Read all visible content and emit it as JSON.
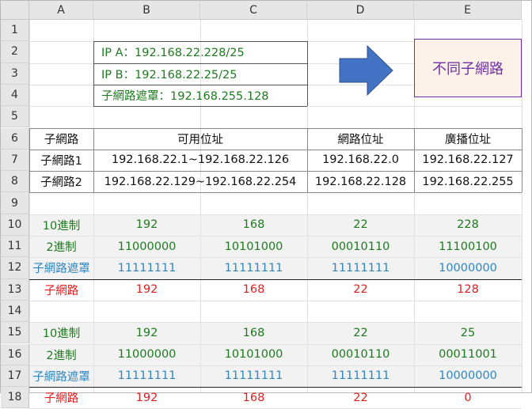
{
  "columns": [
    "A",
    "B",
    "C",
    "D",
    "E"
  ],
  "rows": [
    "1",
    "2",
    "3",
    "4",
    "5",
    "6",
    "7",
    "8",
    "9",
    "10",
    "11",
    "12",
    "13",
    "14",
    "15",
    "16",
    "17",
    "18"
  ],
  "info": {
    "ip_a": "IP A：192.168.22.228/25",
    "ip_b": "IP B：192.168.22.25/25",
    "mask": "子網路遮罩：192.168.255.128"
  },
  "result_box": {
    "text": "不同子網路",
    "border_color": "#7030a0",
    "fill_color": "#fdf2ea"
  },
  "arrow": {
    "color": "#4472c4"
  },
  "table": {
    "headers": [
      "子網路",
      "可用位址",
      "網路位址",
      "廣播位址"
    ],
    "rows": [
      [
        "子網路1",
        "192.168.22.1~192.168.22.126",
        "192.168.22.0",
        "192.168.22.127"
      ],
      [
        "子網路2",
        "192.168.22.129~192.168.22.254",
        "192.168.22.128",
        "192.168.22.255"
      ]
    ]
  },
  "block1": {
    "decimal": {
      "label": "10進制",
      "values": [
        "192",
        "168",
        "22",
        "228"
      ]
    },
    "binary": {
      "label": "2進制",
      "values": [
        "11000000",
        "10101000",
        "00010110",
        "11100100"
      ]
    },
    "mask": {
      "label": "子網路遮罩",
      "values": [
        "11111111",
        "11111111",
        "11111111",
        "10000000"
      ]
    },
    "subnet": {
      "label": "子網路",
      "values": [
        "192",
        "168",
        "22",
        "128"
      ]
    }
  },
  "block2": {
    "decimal": {
      "label": "10進制",
      "values": [
        "192",
        "168",
        "22",
        "25"
      ]
    },
    "binary": {
      "label": "2進制",
      "values": [
        "11000000",
        "10101000",
        "00010110",
        "00011001"
      ]
    },
    "mask": {
      "label": "子網路遮罩",
      "values": [
        "11111111",
        "11111111",
        "11111111",
        "10000000"
      ]
    },
    "subnet": {
      "label": "子網路",
      "values": [
        "192",
        "168",
        "22",
        "0"
      ]
    }
  },
  "colors": {
    "green": "#1e7a1e",
    "blue": "#2e86c1",
    "red": "#e02020"
  }
}
